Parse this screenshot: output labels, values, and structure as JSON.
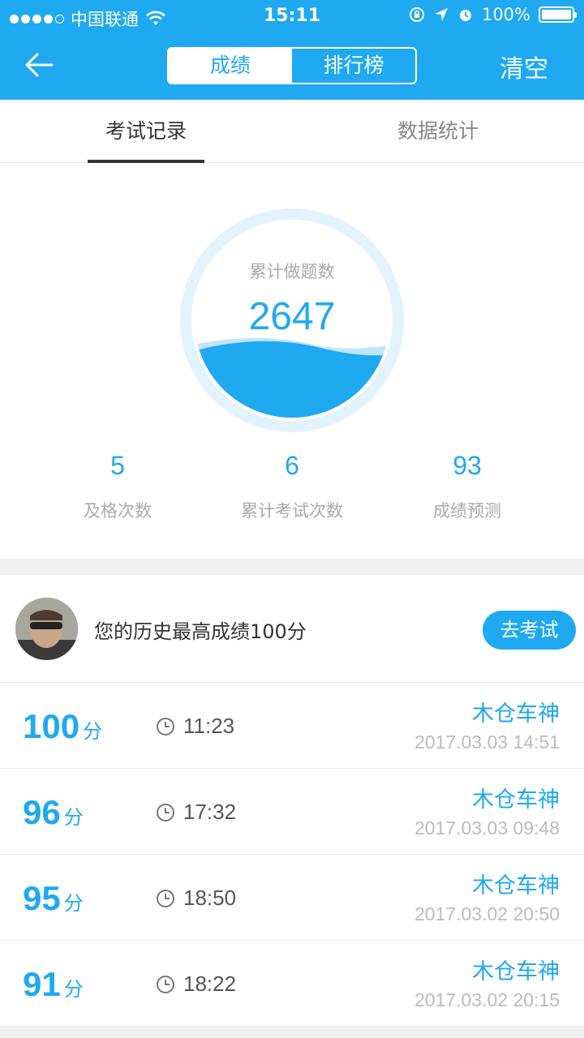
{
  "status_bar": {
    "carrier": "中国联通",
    "time": "15:11",
    "battery": "100%"
  },
  "header": {
    "segments": [
      "成绩",
      "排行榜"
    ],
    "active_segment": "成绩",
    "clear_label": "清空"
  },
  "tabs": [
    {
      "label": "考试记录",
      "active": true
    },
    {
      "label": "数据统计",
      "active": false
    }
  ],
  "summary": {
    "circle_label": "累计做题数",
    "circle_value": "2647",
    "metrics": [
      {
        "value": "5",
        "label": "及格次数"
      },
      {
        "value": "6",
        "label": "累计考试次数"
      },
      {
        "value": "93",
        "label": "成绩预测"
      }
    ]
  },
  "best": {
    "text": "您的历史最高成绩100分",
    "button": "去考试"
  },
  "records": [
    {
      "score": "100",
      "unit": "分",
      "duration": "11:23",
      "name": "木仓车神",
      "date": "2017.03.03 14:51"
    },
    {
      "score": "96",
      "unit": "分",
      "duration": "17:32",
      "name": "木仓车神",
      "date": "2017.03.03 09:48"
    },
    {
      "score": "95",
      "unit": "分",
      "duration": "18:50",
      "name": "木仓车神",
      "date": "2017.03.02 20:50"
    },
    {
      "score": "91",
      "unit": "分",
      "duration": "18:22",
      "name": "木仓车神",
      "date": "2017.03.02 20:15"
    }
  ],
  "colors": {
    "accent": "#1ea9f1",
    "background": "#efefef"
  }
}
